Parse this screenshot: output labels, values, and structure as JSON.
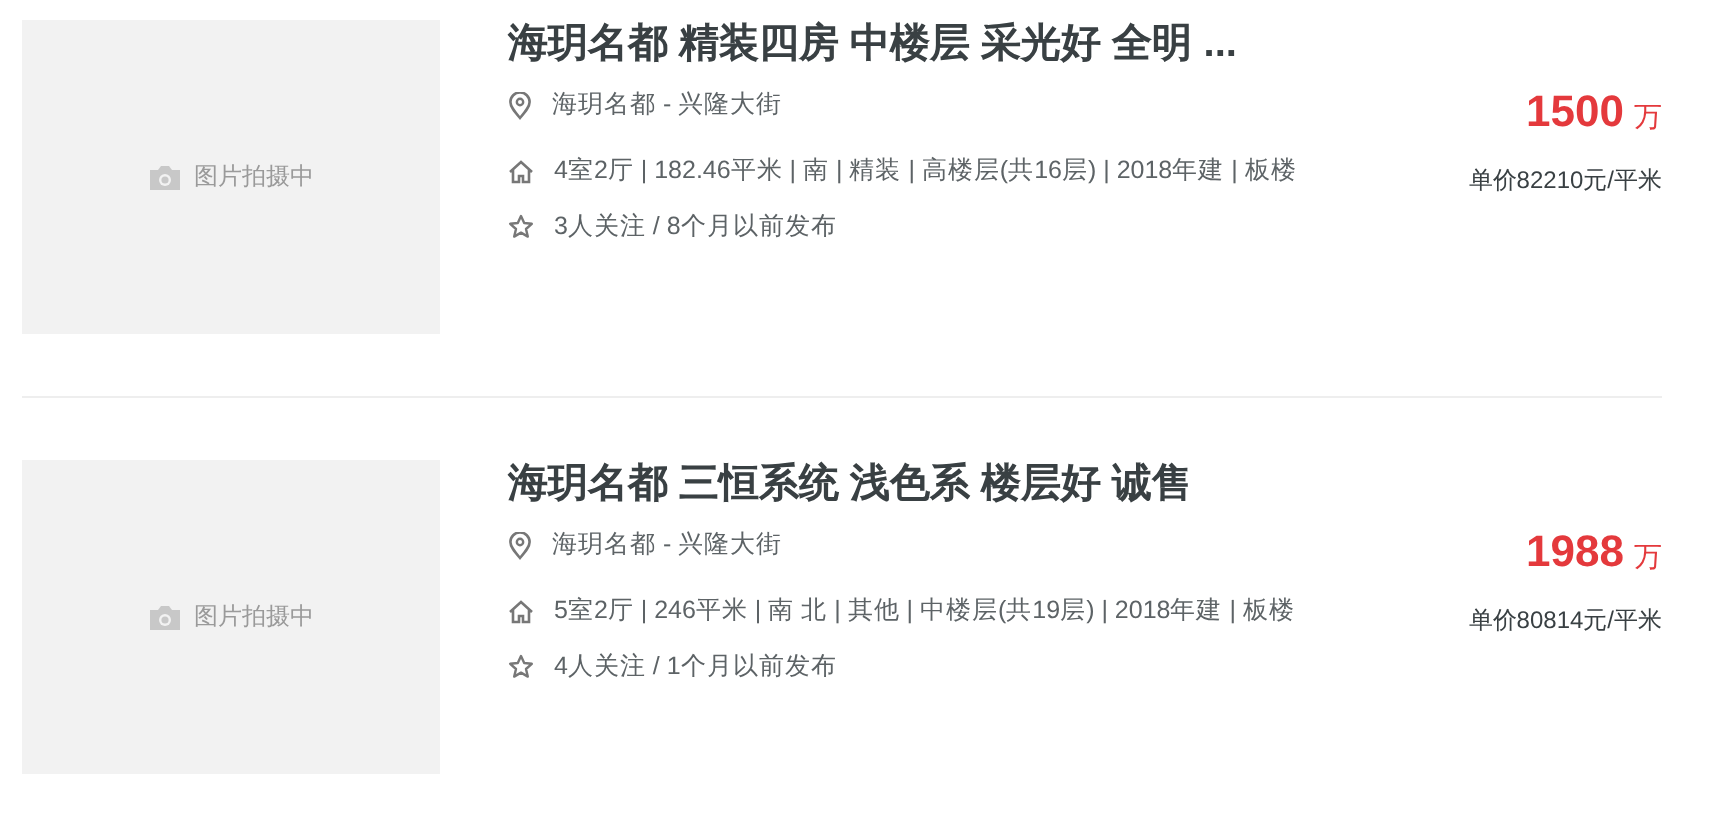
{
  "listings": [
    {
      "photo_placeholder": "图片拍摄中",
      "title": "海玥名都 精装四房 中楼层 采光好 全明 ...",
      "location": "海玥名都 - 兴隆大街",
      "details": "4室2厅 | 182.46平米 | 南 | 精装 | 高楼层(共16层) | 2018年建 | 板楼",
      "followers": "3人关注 / 8个月以前发布",
      "total_price": "1500",
      "price_unit": "万",
      "unit_price": "单价82210元/平米"
    },
    {
      "photo_placeholder": "图片拍摄中",
      "title": "海玥名都 三恒系统 浅色系 楼层好 诚售",
      "location": "海玥名都 - 兴隆大街",
      "details": "5室2厅 | 246平米 | 南 北 | 其他 | 中楼层(共19层) | 2018年建 | 板楼",
      "followers": "4人关注 / 1个月以前发布",
      "total_price": "1988",
      "price_unit": "万",
      "unit_price": "单价80814元/平米"
    }
  ]
}
